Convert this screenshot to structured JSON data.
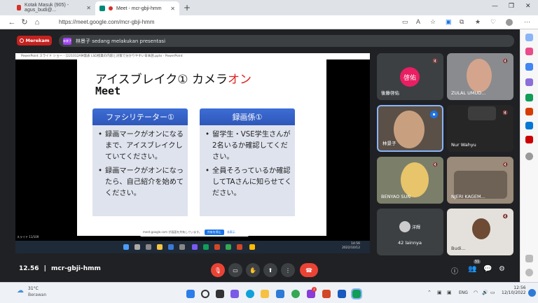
{
  "browser": {
    "tabs": [
      {
        "label": "Kotak Masuk (905) - agus_budi@...",
        "active": false
      },
      {
        "label": "Meet - mcr-gbji-hmm",
        "active": true
      }
    ],
    "url": "https://meet.google.com/mcr-gbji-hmm"
  },
  "meet": {
    "recording_label": "Merekam",
    "presenting_text": "林景子 sedang melakukan presentasi",
    "presenter_avatar": "林景子",
    "meeting_time": "12.56",
    "meeting_code": "mcr-gbji-hmm",
    "participant_count": "51"
  },
  "presentation": {
    "window_title": "PowerPoint スライド ショー - [221012AM発表 LSD授業の内容と対策で分かりやすい日本語.pptx - PowerPoint",
    "title_line1_a": "アイスブレイク① カメラ",
    "title_line1_b": "オン",
    "title_line2": "Meet",
    "box_left_head": "ファシリテーター①",
    "box_left_items": [
      "録画マークがオンになるまで、アイスブレイクしていてください。",
      "録画マークがオンになったら、自己紹介を始めてください。"
    ],
    "box_right_head": "録画係①",
    "box_right_items": [
      "留学生・VSE学生さんが2名いるか確認してください。",
      "全員そろっているか確認してTAさんに知らせてください。"
    ],
    "share_notice": "meet.google.com が画面を共有しています。",
    "share_stop": "共有を停止",
    "share_hide": "非表示",
    "slide_number": "スライド 11/109",
    "remote_clock_time": "14:56",
    "remote_clock_date": "2022/10/12"
  },
  "participants": [
    {
      "name": "後藤啓佑",
      "avatar": "啓佑"
    },
    {
      "name": "ZULAL UMUD..."
    },
    {
      "name": "林景子"
    },
    {
      "name": "Nur Wahyu"
    },
    {
      "name": "BENYAO SUN"
    },
    {
      "name": "NJERI KAGEM..."
    },
    {
      "name": "42 lainnya",
      "avatar": "洋輝"
    },
    {
      "name": "Budi..."
    }
  ],
  "taskbar": {
    "weather_temp": "31°C",
    "weather_text": "Berawan",
    "lang": "ENG",
    "time": "12:56",
    "date": "12/10/2022",
    "badge": "2"
  },
  "colors": {
    "record_red": "#c5221f",
    "end_call_red": "#ea4335",
    "slide_box_blue": "#3d6dd6",
    "title_accent": "#e02020"
  }
}
